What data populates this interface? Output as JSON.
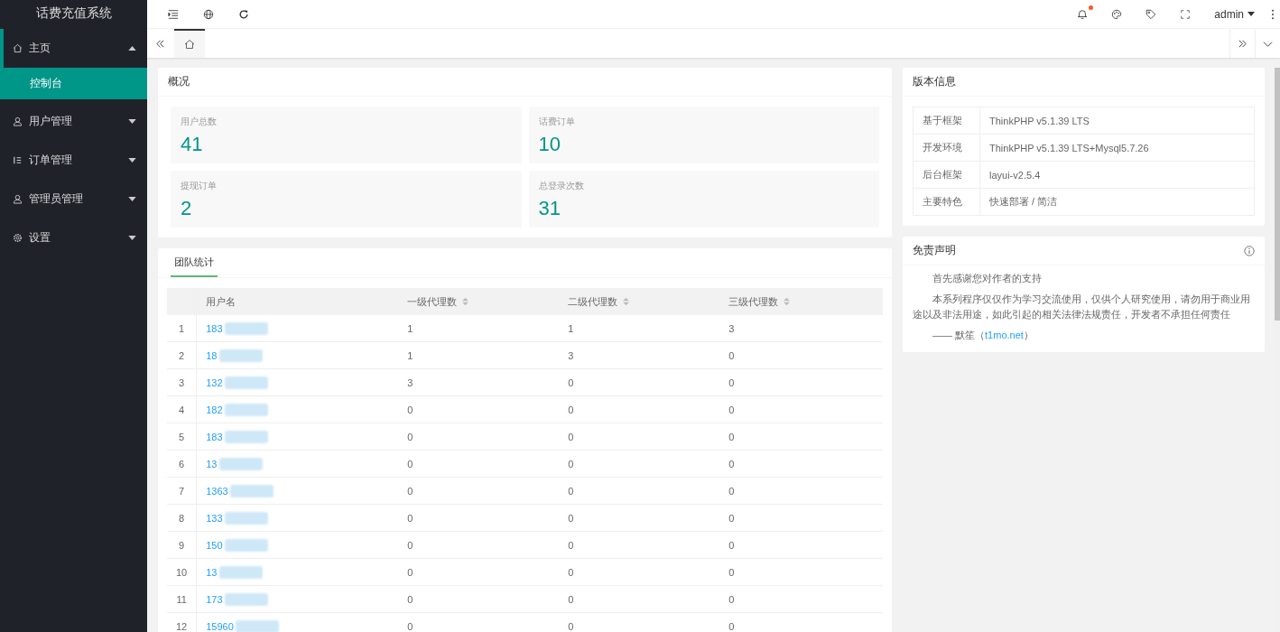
{
  "sidebar": {
    "logo": "话费充值系统",
    "items": [
      {
        "label": "主页",
        "kind": "home",
        "expanded": true,
        "selected": false,
        "children": [
          {
            "label": "控制台",
            "selected": true
          }
        ]
      },
      {
        "label": "用户管理",
        "kind": "user",
        "expanded": false,
        "selected": false
      },
      {
        "label": "订单管理",
        "kind": "list",
        "expanded": false,
        "selected": false
      },
      {
        "label": "管理员管理",
        "kind": "user",
        "expanded": false,
        "selected": false
      },
      {
        "label": "设置",
        "kind": "gear",
        "expanded": false,
        "selected": false
      }
    ]
  },
  "header": {
    "user": "admin",
    "notification_dot": true
  },
  "tabs": [
    {
      "kind": "home",
      "selected": true
    }
  ],
  "overview": {
    "title": "概况",
    "stats": [
      {
        "label": "用户总数",
        "value": "41"
      },
      {
        "label": "话费订单",
        "value": "10"
      },
      {
        "label": "提现订单",
        "value": "2"
      },
      {
        "label": "总登录次数",
        "value": "31"
      }
    ]
  },
  "team": {
    "tab": "团队统计",
    "columns": [
      "用户名",
      "一级代理数",
      "二级代理数",
      "三级代理数"
    ],
    "rows": [
      {
        "index": "1",
        "username": "183",
        "l1": "1",
        "l2": "1",
        "l3": "3"
      },
      {
        "index": "2",
        "username": "18",
        "l1": "1",
        "l2": "3",
        "l3": "0"
      },
      {
        "index": "3",
        "username": "132",
        "l1": "3",
        "l2": "0",
        "l3": "0"
      },
      {
        "index": "4",
        "username": "182",
        "l1": "0",
        "l2": "0",
        "l3": "0"
      },
      {
        "index": "5",
        "username": "183",
        "l1": "0",
        "l2": "0",
        "l3": "0"
      },
      {
        "index": "6",
        "username": "13",
        "l1": "0",
        "l2": "0",
        "l3": "0"
      },
      {
        "index": "7",
        "username": "1363",
        "l1": "0",
        "l2": "0",
        "l3": "0"
      },
      {
        "index": "8",
        "username": "133",
        "l1": "0",
        "l2": "0",
        "l3": "0"
      },
      {
        "index": "9",
        "username": "150",
        "l1": "0",
        "l2": "0",
        "l3": "0"
      },
      {
        "index": "10",
        "username": "13",
        "l1": "0",
        "l2": "0",
        "l3": "0"
      },
      {
        "index": "11",
        "username": "173",
        "l1": "0",
        "l2": "0",
        "l3": "0"
      },
      {
        "index": "12",
        "username": "15960",
        "l1": "0",
        "l2": "0",
        "l3": "0"
      }
    ]
  },
  "version": {
    "title": "版本信息",
    "rows": [
      {
        "label": "基于框架",
        "value": "ThinkPHP v5.1.39 LTS"
      },
      {
        "label": "开发环境",
        "value": "ThinkPHP v5.1.39 LTS+Mysql5.7.26"
      },
      {
        "label": "后台框架",
        "value": "layui-v2.5.4"
      },
      {
        "label": "主要特色",
        "value": "快速部署 / 简洁"
      }
    ]
  },
  "disclaimer": {
    "title": "免责声明",
    "paragraphs": [
      "首先感谢您对作者的支持",
      "本系列程序仅仅作为学习交流使用，仅供个人研究使用，请勿用于商业用途以及非法用途，如此引起的相关法律法规责任，开发者不承担任何责任"
    ],
    "signature": "—— 默笙（",
    "link": "t1mo.net",
    "signature_end": "）"
  }
}
